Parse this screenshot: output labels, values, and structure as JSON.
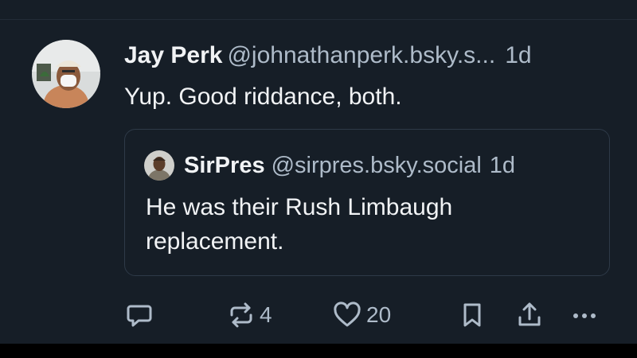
{
  "post": {
    "author": {
      "display_name": "Jay Perk",
      "handle": "@johnathanperk.bsky.s...",
      "avatar_icon": "person-with-mask-avatar"
    },
    "time": "1d",
    "text": "Yup. Good riddance, both.",
    "quote": {
      "author": {
        "display_name": "SirPres",
        "handle": "@sirpres.bsky.social",
        "avatar_icon": "person-avatar"
      },
      "time": "1d",
      "text": "He was their Rush Limbaugh replacement."
    },
    "actions": {
      "reply_icon": "speech-bubble-icon",
      "repost_icon": "repost-arrows-icon",
      "repost_count": "4",
      "like_icon": "heart-icon",
      "like_count": "20",
      "bookmark_icon": "bookmark-icon",
      "share_icon": "share-upload-icon",
      "more_icon": "ellipsis-icon"
    }
  },
  "colors": {
    "background": "#161e27",
    "text_primary": "#f1f3f5",
    "text_secondary": "#aebbc9",
    "quote_border": "#2e3a48"
  }
}
